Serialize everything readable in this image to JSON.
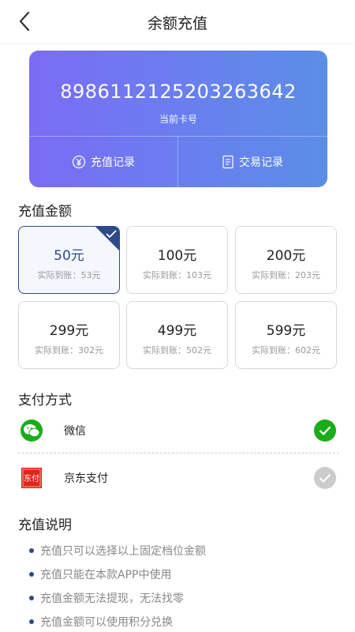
{
  "header": {
    "title": "余额充值",
    "back_icon": "chevron-left-icon"
  },
  "card": {
    "number": "8986112125203263642",
    "label": "当前卡号",
    "actions": [
      {
        "label": "充值记录",
        "icon": "yen-circle-icon"
      },
      {
        "label": "交易记录",
        "icon": "document-icon"
      }
    ],
    "gradient_start": "#7b6cf4",
    "gradient_end": "#5b8ee6"
  },
  "recharge": {
    "title": "充值金额",
    "selected_index": 0,
    "options": [
      {
        "amount": "50元",
        "actual": "实际到账：53元"
      },
      {
        "amount": "100元",
        "actual": "实际到账：103元"
      },
      {
        "amount": "200元",
        "actual": "实际到账：203元"
      },
      {
        "amount": "299元",
        "actual": "实际到账：302元"
      },
      {
        "amount": "499元",
        "actual": "实际到账：502元"
      },
      {
        "amount": "599元",
        "actual": "实际到账：602元"
      }
    ]
  },
  "payment": {
    "title": "支付方式",
    "methods": [
      {
        "name": "微信",
        "icon": "wechat-icon",
        "selected": true
      },
      {
        "name": "京东支付",
        "icon": "jd-pay-icon",
        "icon_text": "东付",
        "selected": false
      }
    ]
  },
  "instructions": {
    "title": "充值说明",
    "items": [
      "充值只可以选择以上固定档位金额",
      "充值只能在本款APP中使用",
      "充值金额无法提现，无法找零",
      "充值金额可以使用积分兑换"
    ]
  },
  "colors": {
    "accent": "#2d4a8a",
    "wechat_green": "#1aad19",
    "jd_red": "#e1251b"
  }
}
